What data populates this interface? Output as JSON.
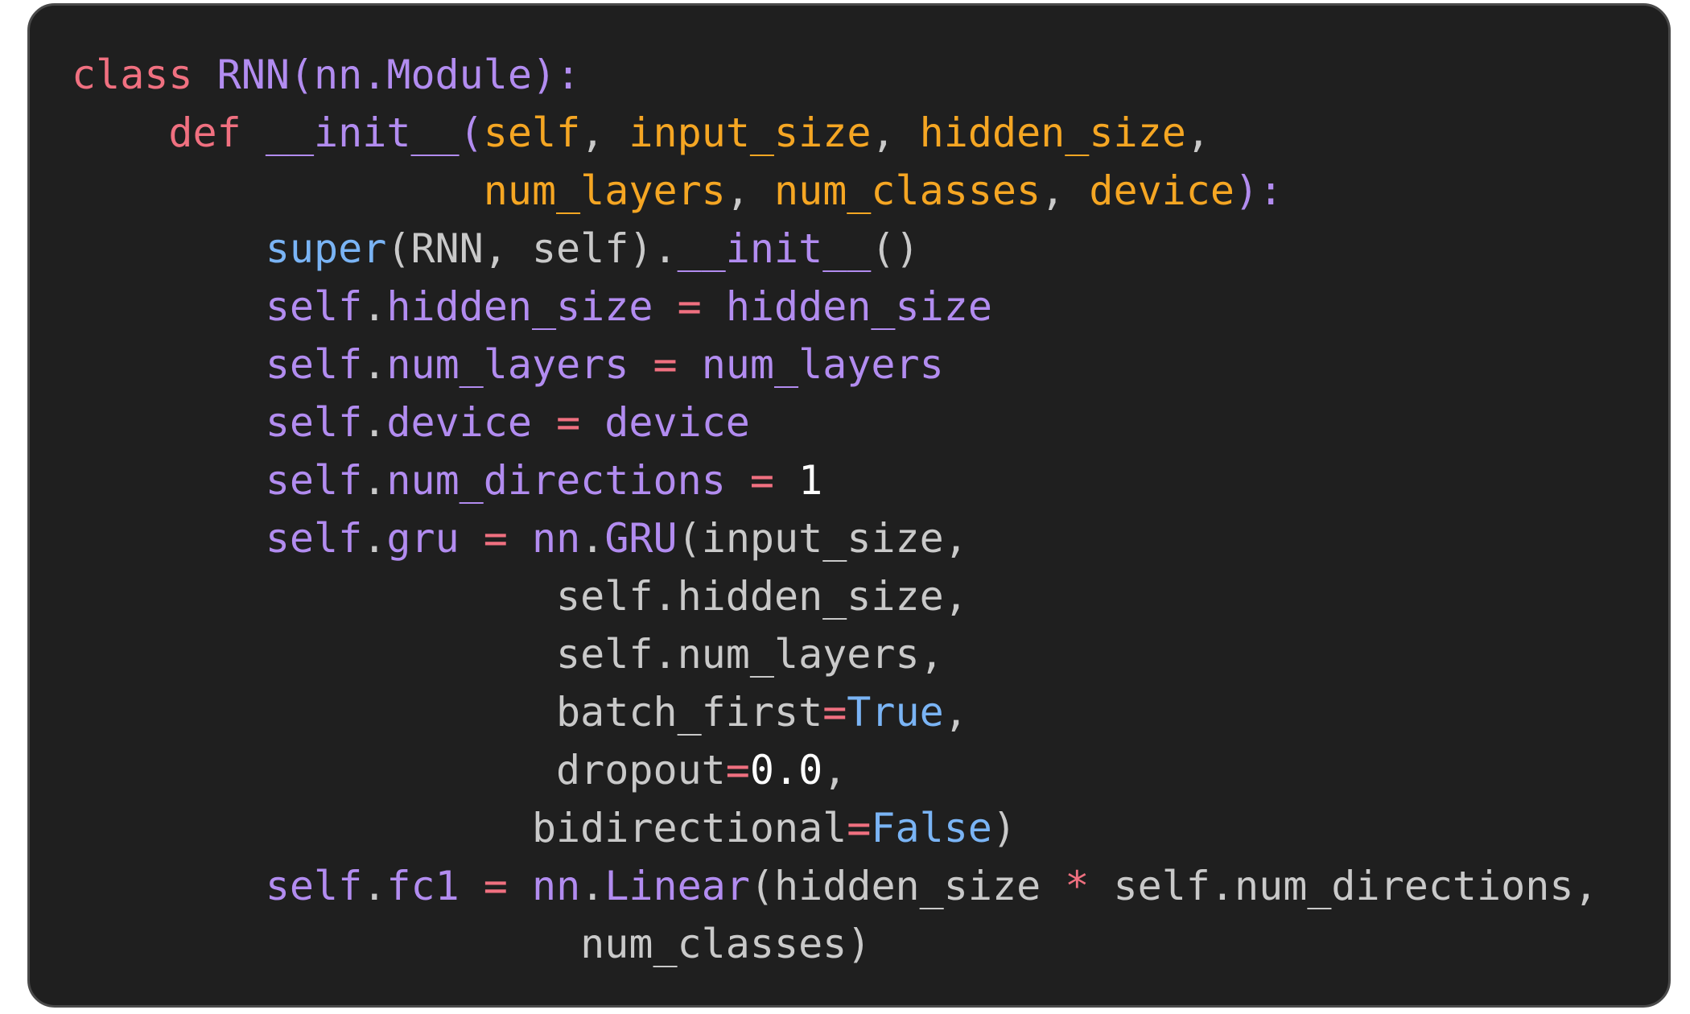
{
  "code": {
    "lines": [
      [
        {
          "t": "class ",
          "c": "kw"
        },
        {
          "t": "RNN(nn.Module):",
          "c": "name"
        }
      ],
      [
        {
          "t": "    ",
          "c": "plain"
        },
        {
          "t": "def ",
          "c": "kw"
        },
        {
          "t": "__init__(",
          "c": "name"
        },
        {
          "t": "self",
          "c": "param"
        },
        {
          "t": ", ",
          "c": "plain"
        },
        {
          "t": "input_size",
          "c": "param"
        },
        {
          "t": ", ",
          "c": "plain"
        },
        {
          "t": "hidden_size",
          "c": "param"
        },
        {
          "t": ",",
          "c": "plain"
        }
      ],
      [
        {
          "t": "                 ",
          "c": "plain"
        },
        {
          "t": "num_layers",
          "c": "param"
        },
        {
          "t": ", ",
          "c": "plain"
        },
        {
          "t": "num_classes",
          "c": "param"
        },
        {
          "t": ", ",
          "c": "plain"
        },
        {
          "t": "device",
          "c": "param"
        },
        {
          "t": "):",
          "c": "name"
        }
      ],
      [
        {
          "t": "        ",
          "c": "plain"
        },
        {
          "t": "super",
          "c": "bi"
        },
        {
          "t": "(RNN, self).",
          "c": "plain"
        },
        {
          "t": "__init__",
          "c": "name"
        },
        {
          "t": "()",
          "c": "plain"
        }
      ],
      [
        {
          "t": "        ",
          "c": "plain"
        },
        {
          "t": "self",
          "c": "name"
        },
        {
          "t": ".",
          "c": "plain"
        },
        {
          "t": "hidden_size",
          "c": "name"
        },
        {
          "t": " = ",
          "c": "op"
        },
        {
          "t": "hidden_size",
          "c": "name"
        }
      ],
      [
        {
          "t": "        ",
          "c": "plain"
        },
        {
          "t": "self",
          "c": "name"
        },
        {
          "t": ".",
          "c": "plain"
        },
        {
          "t": "num_layers",
          "c": "name"
        },
        {
          "t": " = ",
          "c": "op"
        },
        {
          "t": "num_layers",
          "c": "name"
        }
      ],
      [
        {
          "t": "        ",
          "c": "plain"
        },
        {
          "t": "self",
          "c": "name"
        },
        {
          "t": ".",
          "c": "plain"
        },
        {
          "t": "device",
          "c": "name"
        },
        {
          "t": " = ",
          "c": "op"
        },
        {
          "t": "device",
          "c": "name"
        }
      ],
      [
        {
          "t": "        ",
          "c": "plain"
        },
        {
          "t": "self",
          "c": "name"
        },
        {
          "t": ".",
          "c": "plain"
        },
        {
          "t": "num_directions",
          "c": "name"
        },
        {
          "t": " = ",
          "c": "op"
        },
        {
          "t": "1",
          "c": "num"
        }
      ],
      [
        {
          "t": "        ",
          "c": "plain"
        },
        {
          "t": "self",
          "c": "name"
        },
        {
          "t": ".",
          "c": "plain"
        },
        {
          "t": "gru",
          "c": "name"
        },
        {
          "t": " = ",
          "c": "op"
        },
        {
          "t": "nn",
          "c": "name"
        },
        {
          "t": ".",
          "c": "plain"
        },
        {
          "t": "GRU",
          "c": "name"
        },
        {
          "t": "(input_size,",
          "c": "plain"
        }
      ],
      [
        {
          "t": "                    self.hidden_size,",
          "c": "plain"
        }
      ],
      [
        {
          "t": "                    self.num_layers,",
          "c": "plain"
        }
      ],
      [
        {
          "t": "                    batch_first",
          "c": "plain"
        },
        {
          "t": "=",
          "c": "op"
        },
        {
          "t": "True",
          "c": "bi"
        },
        {
          "t": ",",
          "c": "plain"
        }
      ],
      [
        {
          "t": "                    dropout",
          "c": "plain"
        },
        {
          "t": "=",
          "c": "op"
        },
        {
          "t": "0.0",
          "c": "num"
        },
        {
          "t": ",",
          "c": "plain"
        }
      ],
      [
        {
          "t": "                   bidirectional",
          "c": "plain"
        },
        {
          "t": "=",
          "c": "op"
        },
        {
          "t": "False",
          "c": "bi"
        },
        {
          "t": ")",
          "c": "plain"
        }
      ],
      [
        {
          "t": "        ",
          "c": "plain"
        },
        {
          "t": "self",
          "c": "name"
        },
        {
          "t": ".",
          "c": "plain"
        },
        {
          "t": "fc1",
          "c": "name"
        },
        {
          "t": " = ",
          "c": "op"
        },
        {
          "t": "nn",
          "c": "name"
        },
        {
          "t": ".",
          "c": "plain"
        },
        {
          "t": "Linear",
          "c": "name"
        },
        {
          "t": "(hidden_size ",
          "c": "plain"
        },
        {
          "t": "*",
          "c": "op"
        },
        {
          "t": " self.num_directions,",
          "c": "plain"
        }
      ],
      [
        {
          "t": "                     num_classes)",
          "c": "plain"
        }
      ]
    ]
  }
}
